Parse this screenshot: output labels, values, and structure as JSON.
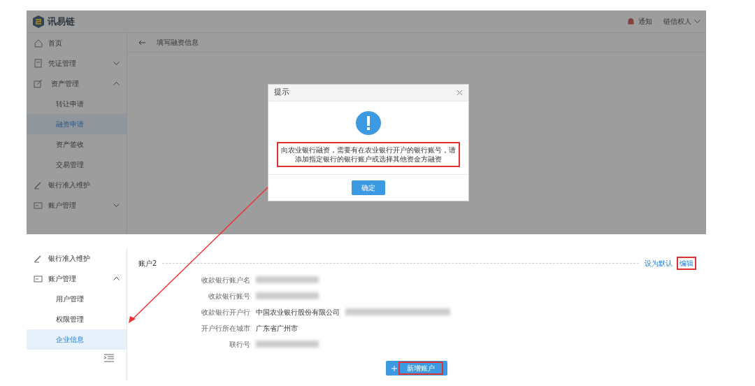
{
  "top_screen": {
    "logo_text": "讯易链",
    "header": {
      "notice": "通知",
      "user": "链信权人"
    },
    "sidebar": [
      {
        "label": "首页",
        "kind": "item",
        "selected": false
      },
      {
        "label": "凭证管理",
        "kind": "group",
        "expanded": false,
        "selected": false
      },
      {
        "label": "资产管理",
        "kind": "group",
        "expanded": true,
        "selected": false
      },
      {
        "label": "转让申请",
        "kind": "sub",
        "selected": false
      },
      {
        "label": "融资申请",
        "kind": "sub",
        "selected": true
      },
      {
        "label": "资产签收",
        "kind": "sub",
        "selected": false
      },
      {
        "label": "交易管理",
        "kind": "sub",
        "selected": false
      },
      {
        "label": "银行准入维护",
        "kind": "item",
        "selected": false
      },
      {
        "label": "账户管理",
        "kind": "group",
        "expanded": false,
        "selected": false
      }
    ],
    "page_title": "填写融资信息",
    "dialog": {
      "title": "提示",
      "message": "向农业银行融资，需要有在农业银行开户的银行账号，请添加指定银行的银行账户或选择其他资金方融资",
      "button": "确定"
    }
  },
  "bottom_screen": {
    "sidebar": [
      {
        "label": "银行准入维护",
        "kind": "item",
        "selected": false
      },
      {
        "label": "账户管理",
        "kind": "group",
        "expanded": true,
        "selected": false
      },
      {
        "label": "用户管理",
        "kind": "sub",
        "selected": false
      },
      {
        "label": "权限管理",
        "kind": "sub",
        "selected": false
      },
      {
        "label": "企业信息",
        "kind": "sub",
        "selected": true
      }
    ],
    "account": {
      "title": "账户2",
      "set_default": "设为默认",
      "edit": "编辑",
      "fields": [
        {
          "label": "收款银行账户名",
          "blurred": true
        },
        {
          "label": "收款银行账号",
          "blurred": true
        },
        {
          "label": "收款银行开户行",
          "value": "中国农业银行股份有限公司",
          "blurred": true
        },
        {
          "label": "开户行所在城市",
          "value": "广东省广州市",
          "blurred": false
        },
        {
          "label": "联行号",
          "blurred": true
        }
      ]
    },
    "add_button": "新增账户"
  }
}
